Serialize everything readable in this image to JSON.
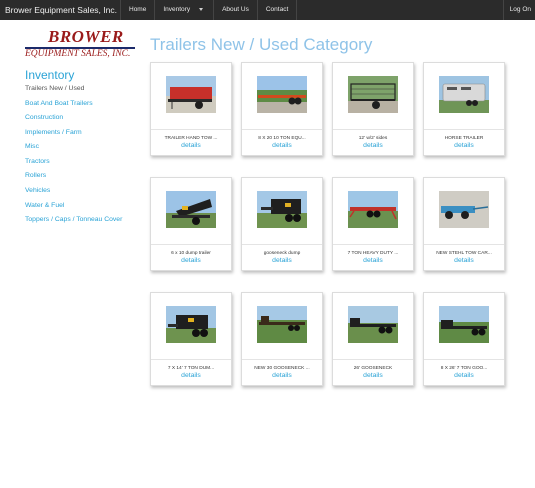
{
  "nav": {
    "brand": "Brower Equipment Sales, Inc.",
    "links": [
      "Home",
      "Inventory",
      "About Us",
      "Contact"
    ],
    "login": "Log On"
  },
  "logo": {
    "line1": "BROWER",
    "line2": "EQUIPMENT SALES, INC."
  },
  "sidebar": {
    "heading": "Inventory",
    "current": "Trailers New / Used",
    "items": [
      "Boat And Boat Trailers",
      "Construction",
      "Implements / Farm",
      "Misc",
      "Tractors",
      "Rollers",
      "Vehicles",
      "Water & Fuel",
      "Toppers / Caps / Tonneau Cover"
    ]
  },
  "main": {
    "title": "Trailers New / Used Category",
    "details_label": "details",
    "products": [
      {
        "title": "TRAILER HAND TOW ...",
        "icon": "red-utility-trailer-photo"
      },
      {
        "title": "8 X 20 10 TON EQU...",
        "icon": "flatbed-equipment-trailer-photo"
      },
      {
        "title": "12' w/2' sides",
        "icon": "mesh-side-utility-trailer-photo"
      },
      {
        "title": "HORSE TRAILER",
        "icon": "horse-trailer-photo"
      },
      {
        "title": "6 x 10 dump trailer",
        "icon": "dump-trailer-photo"
      },
      {
        "title": "gooseneck dump",
        "icon": "gooseneck-dump-trailer-photo"
      },
      {
        "title": "7 TON HEAVY DUTY ...",
        "icon": "red-equipment-trailer-photo"
      },
      {
        "title": "NEW STEHL TOW CAR...",
        "icon": "tow-dolly-photo"
      },
      {
        "title": "7 X 14' 7 TON DUM...",
        "icon": "dump-trailer-photo"
      },
      {
        "title": "NEW 30 GOOSENECK ...",
        "icon": "gooseneck-flatbed-trailer-photo"
      },
      {
        "title": "26' GOOSENECK",
        "icon": "gooseneck-trailer-photo"
      },
      {
        "title": "8 X 26' 7 TON GOO...",
        "icon": "gooseneck-trailer-photo"
      }
    ]
  },
  "colors": {
    "navbar": "#2b2b2b",
    "accent_link": "#2aa3d6",
    "title": "#8fc3e8",
    "logo_red": "#9a1a1a",
    "logo_rule": "#1c2a6a"
  }
}
